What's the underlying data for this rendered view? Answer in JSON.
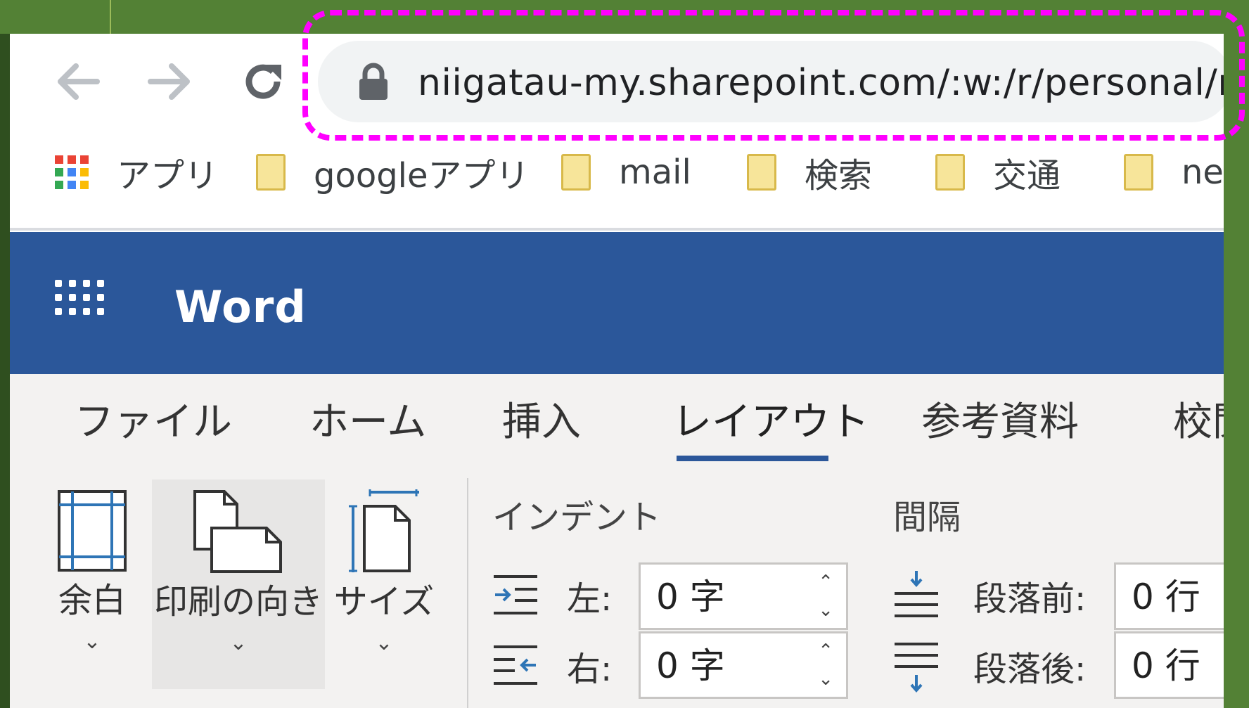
{
  "browser": {
    "nav": {
      "back_icon": "arrow-left-icon",
      "forward_icon": "arrow-right-icon",
      "reload_icon": "reload-icon"
    },
    "address_bar": {
      "lock_icon": "lock-icon",
      "url": "niigatau-my.sharepoint.com/:w:/r/personal/r"
    },
    "bookmarks": [
      {
        "label": "アプリ",
        "icon": "apps-grid-icon"
      },
      {
        "label": "googleアプリ",
        "icon": "folder-icon"
      },
      {
        "label": "mail",
        "icon": "folder-icon"
      },
      {
        "label": "検索",
        "icon": "folder-icon"
      },
      {
        "label": "交通",
        "icon": "folder-icon"
      },
      {
        "label": "ne",
        "icon": "folder-icon"
      }
    ]
  },
  "word": {
    "app_launcher_icon": "waffle-icon",
    "title": "Word",
    "tabs": [
      {
        "label": "ファイル",
        "active": false
      },
      {
        "label": "ホーム",
        "active": false
      },
      {
        "label": "挿入",
        "active": false
      },
      {
        "label": "レイアウト",
        "active": true
      },
      {
        "label": "参考資料",
        "active": false
      },
      {
        "label": "校閲",
        "active": false
      }
    ],
    "ribbon": {
      "margins": {
        "label": "余白",
        "icon": "margins-icon"
      },
      "orientation": {
        "label": "印刷の向き",
        "icon": "orientation-icon"
      },
      "size": {
        "label": "サイズ",
        "icon": "page-size-icon"
      },
      "indent": {
        "title": "インデント",
        "left_label": "左:",
        "left_value": "0 字",
        "right_label": "右:",
        "right_value": "0 字"
      },
      "spacing": {
        "title": "間隔",
        "before_label": "段落前:",
        "before_value": "0 行",
        "after_label": "段落後:",
        "after_value": "0 行"
      }
    }
  },
  "colors": {
    "word_blue": "#2b579a",
    "highlight": "#ff00ff",
    "desktop_green": "#538135"
  }
}
